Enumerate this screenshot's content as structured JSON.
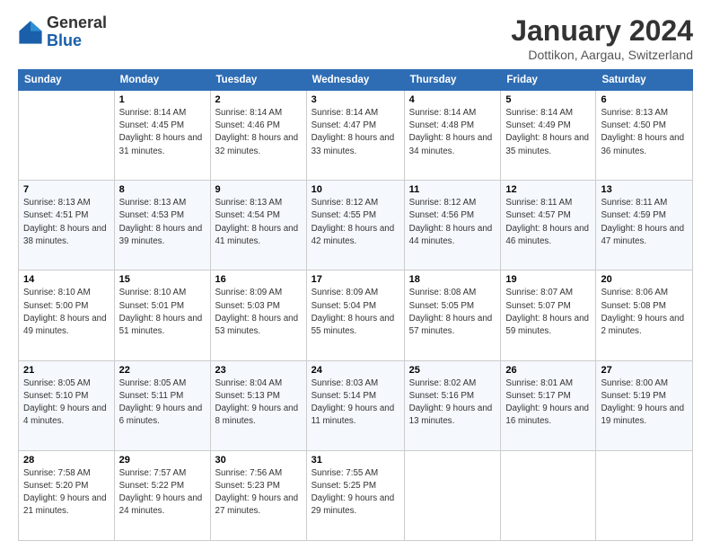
{
  "logo": {
    "general": "General",
    "blue": "Blue"
  },
  "title": "January 2024",
  "subtitle": "Dottikon, Aargau, Switzerland",
  "weekdays": [
    "Sunday",
    "Monday",
    "Tuesday",
    "Wednesday",
    "Thursday",
    "Friday",
    "Saturday"
  ],
  "weeks": [
    [
      {
        "day": "",
        "info": ""
      },
      {
        "day": "1",
        "info": "Sunrise: 8:14 AM\nSunset: 4:45 PM\nDaylight: 8 hours\nand 31 minutes."
      },
      {
        "day": "2",
        "info": "Sunrise: 8:14 AM\nSunset: 4:46 PM\nDaylight: 8 hours\nand 32 minutes."
      },
      {
        "day": "3",
        "info": "Sunrise: 8:14 AM\nSunset: 4:47 PM\nDaylight: 8 hours\nand 33 minutes."
      },
      {
        "day": "4",
        "info": "Sunrise: 8:14 AM\nSunset: 4:48 PM\nDaylight: 8 hours\nand 34 minutes."
      },
      {
        "day": "5",
        "info": "Sunrise: 8:14 AM\nSunset: 4:49 PM\nDaylight: 8 hours\nand 35 minutes."
      },
      {
        "day": "6",
        "info": "Sunrise: 8:13 AM\nSunset: 4:50 PM\nDaylight: 8 hours\nand 36 minutes."
      }
    ],
    [
      {
        "day": "7",
        "info": ""
      },
      {
        "day": "8",
        "info": "Sunrise: 8:13 AM\nSunset: 4:53 PM\nDaylight: 8 hours\nand 39 minutes."
      },
      {
        "day": "9",
        "info": "Sunrise: 8:13 AM\nSunset: 4:54 PM\nDaylight: 8 hours\nand 41 minutes."
      },
      {
        "day": "10",
        "info": "Sunrise: 8:12 AM\nSunset: 4:55 PM\nDaylight: 8 hours\nand 42 minutes."
      },
      {
        "day": "11",
        "info": "Sunrise: 8:12 AM\nSunset: 4:56 PM\nDaylight: 8 hours\nand 44 minutes."
      },
      {
        "day": "12",
        "info": "Sunrise: 8:11 AM\nSunset: 4:57 PM\nDaylight: 8 hours\nand 46 minutes."
      },
      {
        "day": "13",
        "info": "Sunrise: 8:11 AM\nSunset: 4:59 PM\nDaylight: 8 hours\nand 47 minutes."
      }
    ],
    [
      {
        "day": "14",
        "info": ""
      },
      {
        "day": "15",
        "info": "Sunrise: 8:10 AM\nSunset: 5:01 PM\nDaylight: 8 hours\nand 51 minutes."
      },
      {
        "day": "16",
        "info": "Sunrise: 8:09 AM\nSunset: 5:03 PM\nDaylight: 8 hours\nand 53 minutes."
      },
      {
        "day": "17",
        "info": "Sunrise: 8:09 AM\nSunset: 5:04 PM\nDaylight: 8 hours\nand 55 minutes."
      },
      {
        "day": "18",
        "info": "Sunrise: 8:08 AM\nSunset: 5:05 PM\nDaylight: 8 hours\nand 57 minutes."
      },
      {
        "day": "19",
        "info": "Sunrise: 8:07 AM\nSunset: 5:07 PM\nDaylight: 8 hours\nand 59 minutes."
      },
      {
        "day": "20",
        "info": "Sunrise: 8:06 AM\nSunset: 5:08 PM\nDaylight: 9 hours\nand 2 minutes."
      }
    ],
    [
      {
        "day": "21",
        "info": "Sunrise: 8:05 AM\nSunset: 5:10 PM\nDaylight: 9 hours\nand 4 minutes."
      },
      {
        "day": "22",
        "info": "Sunrise: 8:05 AM\nSunset: 5:11 PM\nDaylight: 9 hours\nand 6 minutes."
      },
      {
        "day": "23",
        "info": "Sunrise: 8:04 AM\nSunset: 5:13 PM\nDaylight: 9 hours\nand 8 minutes."
      },
      {
        "day": "24",
        "info": "Sunrise: 8:03 AM\nSunset: 5:14 PM\nDaylight: 9 hours\nand 11 minutes."
      },
      {
        "day": "25",
        "info": "Sunrise: 8:02 AM\nSunset: 5:16 PM\nDaylight: 9 hours\nand 13 minutes."
      },
      {
        "day": "26",
        "info": "Sunrise: 8:01 AM\nSunset: 5:17 PM\nDaylight: 9 hours\nand 16 minutes."
      },
      {
        "day": "27",
        "info": "Sunrise: 8:00 AM\nSunset: 5:19 PM\nDaylight: 9 hours\nand 19 minutes."
      }
    ],
    [
      {
        "day": "28",
        "info": "Sunrise: 7:58 AM\nSunset: 5:20 PM\nDaylight: 9 hours\nand 21 minutes."
      },
      {
        "day": "29",
        "info": "Sunrise: 7:57 AM\nSunset: 5:22 PM\nDaylight: 9 hours\nand 24 minutes."
      },
      {
        "day": "30",
        "info": "Sunrise: 7:56 AM\nSunset: 5:23 PM\nDaylight: 9 hours\nand 27 minutes."
      },
      {
        "day": "31",
        "info": "Sunrise: 7:55 AM\nSunset: 5:25 PM\nDaylight: 9 hours\nand 29 minutes."
      },
      {
        "day": "",
        "info": ""
      },
      {
        "day": "",
        "info": ""
      },
      {
        "day": "",
        "info": ""
      }
    ]
  ],
  "week1_sunday_info": "Sunrise: 8:13 AM\nSunset: 4:51 PM\nDaylight: 8 hours\nand 38 minutes.",
  "week2_sunday_info": "Sunrise: 8:10 AM\nSunset: 5:00 PM\nDaylight: 8 hours\nand 49 minutes."
}
